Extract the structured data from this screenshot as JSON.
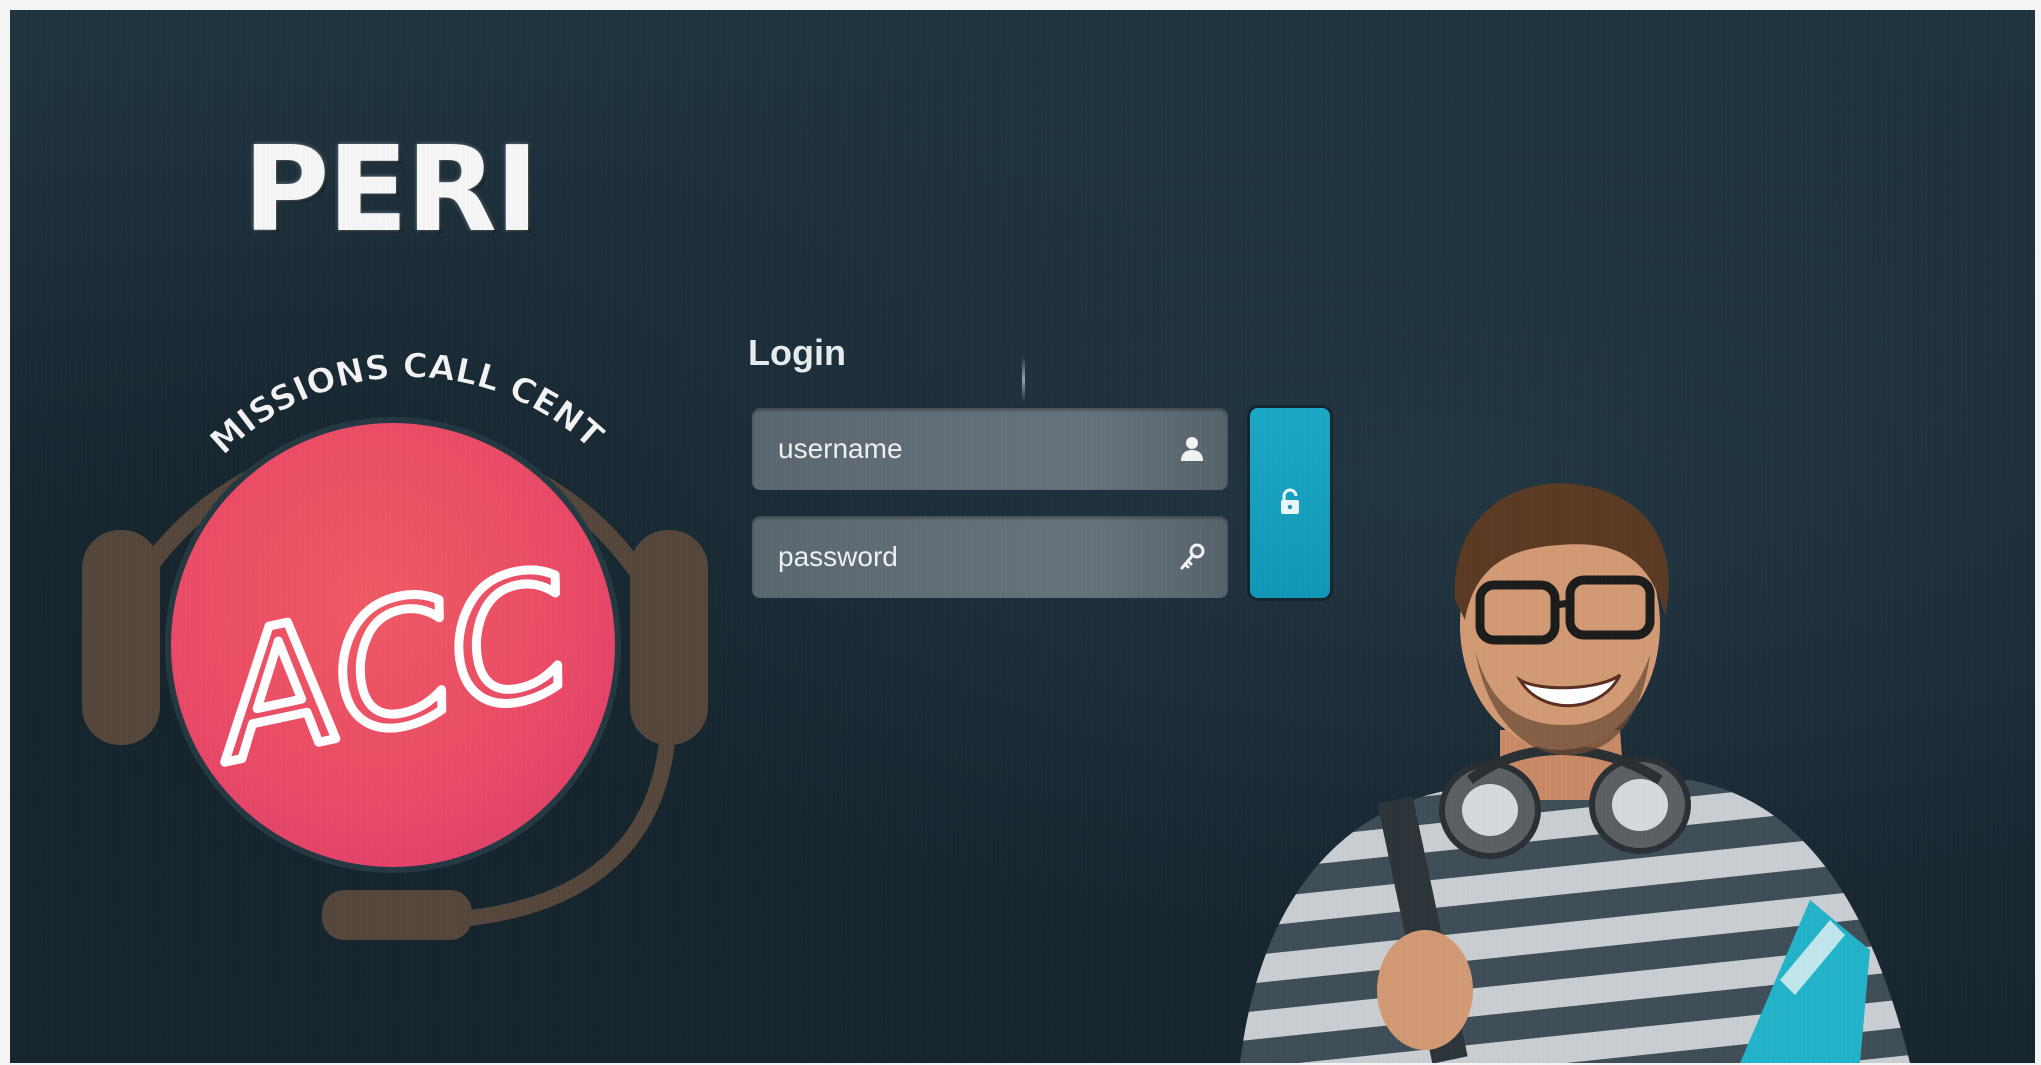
{
  "brand": {
    "name": "PERI"
  },
  "logo": {
    "arc_text": "ADMISSIONS CALL CENTRE",
    "initials": "ACC"
  },
  "login": {
    "title": "Login",
    "username": {
      "placeholder": "username",
      "value": "",
      "icon": "user-icon"
    },
    "password": {
      "placeholder": "password",
      "value": "",
      "icon": "key-icon"
    },
    "submit_icon": "unlock-icon"
  },
  "illustration": {
    "subject": "student-with-headphones"
  },
  "colors": {
    "background": "#1c2e38",
    "accent": "#1ba7c6",
    "logo_disc": "#ef5063",
    "headset": "#54463a",
    "field": "#606d74"
  }
}
